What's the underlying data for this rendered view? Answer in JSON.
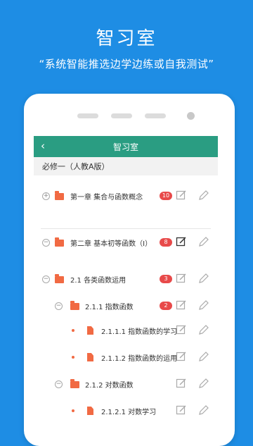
{
  "promo": {
    "title": "智习室",
    "subtitle": "“系统智能推选边学边练或自我测试”"
  },
  "app": {
    "title": "智习室",
    "section": "必修一（人教A版）"
  },
  "tree": [
    {
      "label": "第一章 集合与函数概念",
      "badge": "10"
    },
    {
      "label": "第二章 基本初等函数（Ⅰ）",
      "badge": "8"
    },
    {
      "label": "2.1 各类函数运用",
      "badge": "3"
    },
    {
      "label": "2.1.1 指数函数",
      "badge": "2"
    },
    {
      "label": "2.1.1.1 指数函数的学习"
    },
    {
      "label": "2.1.1.2 指数函数的运用"
    },
    {
      "label": "2.1.2 对数函数"
    },
    {
      "label": "2.1.2.1 对数学习"
    }
  ],
  "colors": {
    "background": "#1e8de4",
    "appbar": "#2a9d82",
    "folder": "#f16a43",
    "badge": "#e84a4a"
  },
  "icons": [
    "back-icon",
    "collapse-icon",
    "expand-icon",
    "folder-icon",
    "document-icon",
    "edit-icon",
    "pencil-icon"
  ]
}
